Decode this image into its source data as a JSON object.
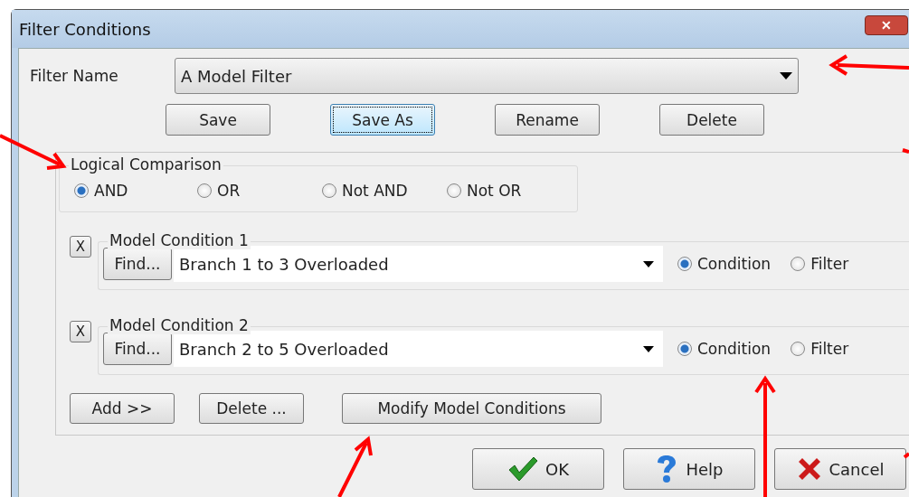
{
  "window": {
    "title": "Filter Conditions",
    "close_label": "✕"
  },
  "filter_name": {
    "label": "Filter Name",
    "value": "A Model Filter"
  },
  "filter_buttons": [
    {
      "label": "Save",
      "focused": false
    },
    {
      "label": "Save As",
      "focused": true
    },
    {
      "label": "Rename",
      "focused": false
    },
    {
      "label": "Delete",
      "focused": false
    }
  ],
  "logical_comparison": {
    "legend": "Logical Comparison",
    "options": [
      {
        "label": "AND",
        "selected": true
      },
      {
        "label": "OR",
        "selected": false
      },
      {
        "label": "Not AND",
        "selected": false
      },
      {
        "label": "Not OR",
        "selected": false
      }
    ]
  },
  "conditions": [
    {
      "legend": "Model Condition 1",
      "remove_label": "X",
      "find_label": "Find...",
      "value": "Branch 1 to 3 Overloaded",
      "modes": [
        {
          "label": "Condition",
          "selected": true
        },
        {
          "label": "Filter",
          "selected": false
        }
      ]
    },
    {
      "legend": "Model Condition 2",
      "remove_label": "X",
      "find_label": "Find...",
      "value": "Branch 2 to 5 Overloaded",
      "modes": [
        {
          "label": "Condition",
          "selected": true
        },
        {
          "label": "Filter",
          "selected": false
        }
      ]
    }
  ],
  "condition_buttons": [
    "Add >>",
    "Delete ...",
    "Modify Model Conditions"
  ],
  "footer_buttons": [
    {
      "label": "OK",
      "kind": "ok"
    },
    {
      "label": "Help",
      "kind": "help"
    },
    {
      "label": "Cancel",
      "kind": "cancel"
    }
  ]
}
